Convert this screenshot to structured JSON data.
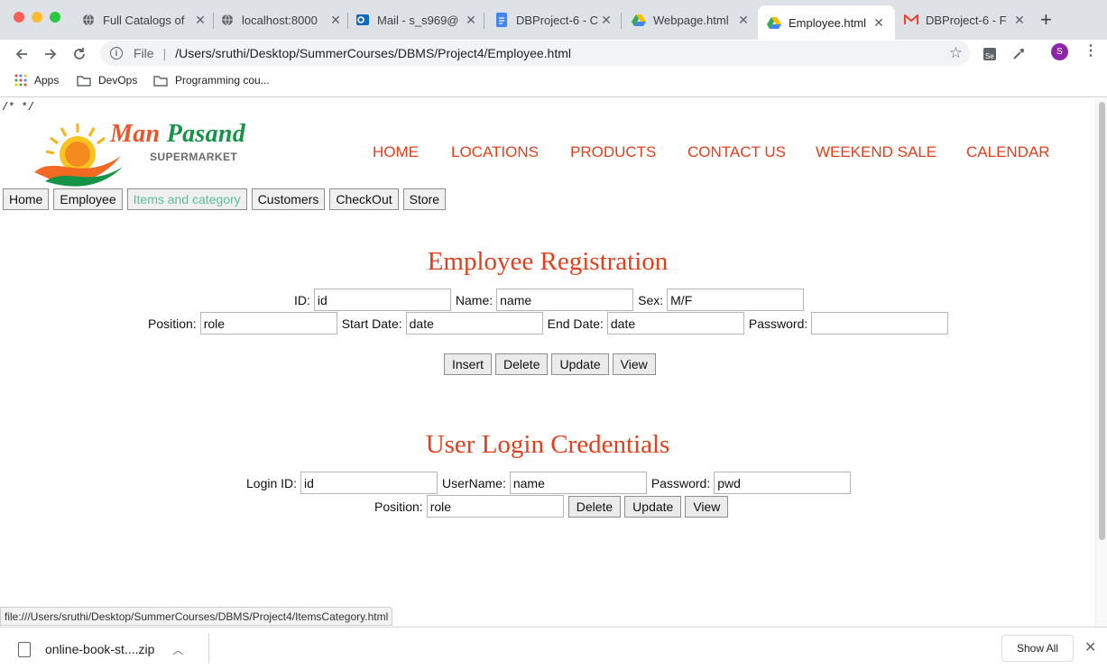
{
  "browser": {
    "tabs": [
      {
        "label": "Full Catalogs of",
        "icon": "globe-icon"
      },
      {
        "label": "localhost:8000",
        "icon": "globe-icon"
      },
      {
        "label": "Mail - s_s969@",
        "icon": "outlook-icon"
      },
      {
        "label": "DBProject-6 - C",
        "icon": "docs-icon"
      },
      {
        "label": "Webpage.html",
        "icon": "drive-icon"
      },
      {
        "label": "Employee.html",
        "icon": "drive-icon"
      },
      {
        "label": "DBProject-6 - F",
        "icon": "gmail-icon"
      }
    ],
    "active_tab": 5,
    "address": {
      "scheme": "File",
      "path": "/Users/sruthi/Desktop/SummerCourses/DBMS/Project4/Employee.html"
    },
    "profile_initial": "S",
    "bookmarks": [
      {
        "label": "Apps",
        "icon": "apps-grid-icon"
      },
      {
        "label": "DevOps",
        "icon": "folder-icon"
      },
      {
        "label": "Programming cou...",
        "icon": "folder-icon"
      }
    ],
    "status_url": "file:///Users/sruthi/Desktop/SummerCourses/DBMS/Project4/ItemsCategory.html",
    "downloads": {
      "filename": "online-book-st....zip",
      "show_all": "Show All"
    }
  },
  "page": {
    "css_comment": "/* */",
    "logo": {
      "word1": "Man",
      "word2": "Pasand",
      "subtitle": "SUPERMARKET"
    },
    "top_nav": [
      "HOME",
      "LOCATIONS",
      "PRODUCTS",
      "CONTACT US",
      "WEEKEND SALE",
      "CALENDAR"
    ],
    "tabs": [
      "Home",
      "Employee",
      "Items and category",
      "Customers",
      "CheckOut",
      "Store"
    ],
    "hovered_tab": 2,
    "employee": {
      "title": "Employee Registration",
      "fields": {
        "id": {
          "label": "ID:",
          "placeholder": "id"
        },
        "name": {
          "label": "Name:",
          "placeholder": "name"
        },
        "sex": {
          "label": "Sex:",
          "placeholder": "M/F"
        },
        "position": {
          "label": "Position:",
          "placeholder": "role"
        },
        "start": {
          "label": "Start Date:",
          "placeholder": "date"
        },
        "end": {
          "label": "End Date:",
          "placeholder": "date"
        },
        "password": {
          "label": "Password:",
          "placeholder": ""
        }
      },
      "buttons": {
        "insert": "Insert",
        "delete": "Delete",
        "update": "Update",
        "view": "View"
      }
    },
    "login": {
      "title": "User Login Credentials",
      "fields": {
        "login_id": {
          "label": "Login ID:",
          "placeholder": "id"
        },
        "username": {
          "label": "UserName:",
          "placeholder": "name"
        },
        "password": {
          "label": "Password:",
          "placeholder": "pwd"
        },
        "position": {
          "label": "Position:",
          "placeholder": "role"
        }
      },
      "buttons": {
        "delete": "Delete",
        "update": "Update",
        "view": "View"
      }
    }
  },
  "colors": {
    "accent": "#e2401c",
    "brand_green": "#159447",
    "tab_hover": "#5bbfa0"
  }
}
